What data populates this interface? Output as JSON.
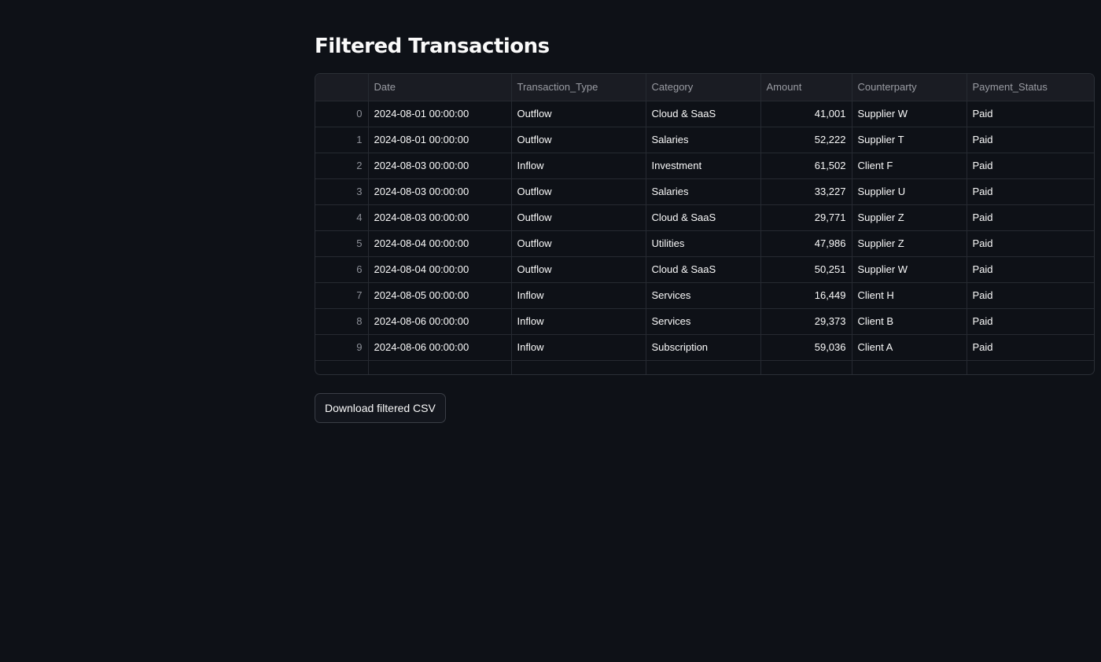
{
  "page": {
    "title": "Filtered Transactions"
  },
  "table": {
    "columns": [
      "",
      "Date",
      "Transaction_Type",
      "Category",
      "Amount",
      "Counterparty",
      "Payment_Status"
    ],
    "rows": [
      {
        "index": "0",
        "date": "2024-08-01 00:00:00",
        "type": "Outflow",
        "category": "Cloud & SaaS",
        "amount": "41,001",
        "counterparty": "Supplier W",
        "status": "Paid"
      },
      {
        "index": "1",
        "date": "2024-08-01 00:00:00",
        "type": "Outflow",
        "category": "Salaries",
        "amount": "52,222",
        "counterparty": "Supplier T",
        "status": "Paid"
      },
      {
        "index": "2",
        "date": "2024-08-03 00:00:00",
        "type": "Inflow",
        "category": "Investment",
        "amount": "61,502",
        "counterparty": "Client F",
        "status": "Paid"
      },
      {
        "index": "3",
        "date": "2024-08-03 00:00:00",
        "type": "Outflow",
        "category": "Salaries",
        "amount": "33,227",
        "counterparty": "Supplier U",
        "status": "Paid"
      },
      {
        "index": "4",
        "date": "2024-08-03 00:00:00",
        "type": "Outflow",
        "category": "Cloud & SaaS",
        "amount": "29,771",
        "counterparty": "Supplier Z",
        "status": "Paid"
      },
      {
        "index": "5",
        "date": "2024-08-04 00:00:00",
        "type": "Outflow",
        "category": "Utilities",
        "amount": "47,986",
        "counterparty": "Supplier Z",
        "status": "Paid"
      },
      {
        "index": "6",
        "date": "2024-08-04 00:00:00",
        "type": "Outflow",
        "category": "Cloud & SaaS",
        "amount": "50,251",
        "counterparty": "Supplier W",
        "status": "Paid"
      },
      {
        "index": "7",
        "date": "2024-08-05 00:00:00",
        "type": "Inflow",
        "category": "Services",
        "amount": "16,449",
        "counterparty": "Client H",
        "status": "Paid"
      },
      {
        "index": "8",
        "date": "2024-08-06 00:00:00",
        "type": "Inflow",
        "category": "Services",
        "amount": "29,373",
        "counterparty": "Client B",
        "status": "Paid"
      },
      {
        "index": "9",
        "date": "2024-08-06 00:00:00",
        "type": "Inflow",
        "category": "Subscription",
        "amount": "59,036",
        "counterparty": "Client A",
        "status": "Paid"
      }
    ]
  },
  "actions": {
    "download_label": "Download filtered CSV"
  }
}
